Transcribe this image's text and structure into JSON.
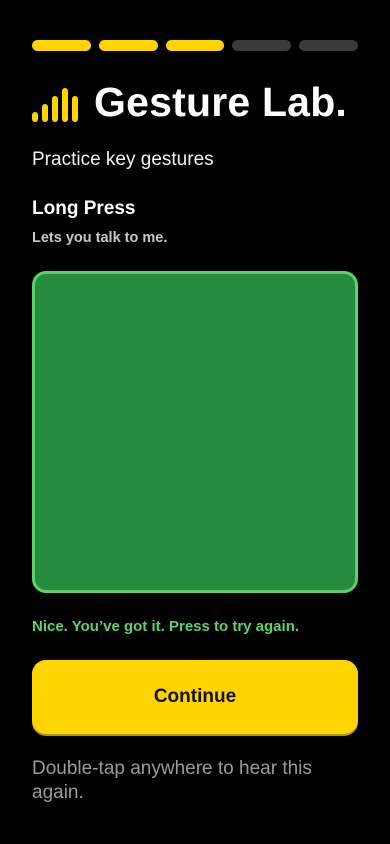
{
  "progress": {
    "total_steps": 5,
    "completed_steps": 3
  },
  "header": {
    "title": "Gesture Lab.",
    "logo_icon": "signal-bars-icon"
  },
  "subtitle": "Practice key gestures",
  "gesture": {
    "name": "Long Press",
    "description": "Lets you talk to me."
  },
  "feedback": {
    "text": "Nice. You’ve got it. Press to try again."
  },
  "continue_button": {
    "label": "Continue"
  },
  "hint": "Double-tap anywhere to hear this again.",
  "colors": {
    "accent": "#ffd400",
    "accent_shadow": "#b89600",
    "background": "#000000",
    "track": "#3a3a3a",
    "pad_fill": "#268c3f",
    "pad_border": "#5fd06a",
    "success_text": "#5fd06a",
    "muted_text": "#9a9a9a"
  }
}
